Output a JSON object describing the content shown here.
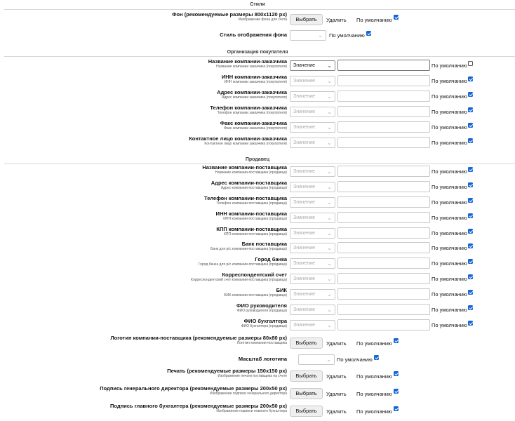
{
  "styles": {
    "title": "Стили",
    "background": {
      "label": "Фон (рекомендуемые размеры 800x1120 px)",
      "sub": "Изображение фона для счета",
      "button": "Выбрать",
      "delete": "Удалить",
      "default_label": "По умолчанию",
      "default_checked": true
    },
    "bg_display": {
      "label": "Стиль отображения фона",
      "default_label": "По умолчанию",
      "default_checked": true
    }
  },
  "buyer": {
    "title": "Организация покупателя",
    "rows": [
      {
        "label": "Название компании-заказчика",
        "sub": "Название компании заказчика (покупателя)",
        "select": "Значение",
        "default_label": "По умолчанию",
        "checked": false,
        "active": true
      },
      {
        "label": "ИНН компании-заказчика",
        "sub": "ИНН компании заказчика (покупателя)",
        "select": "Значение",
        "default_label": "По умолчанию",
        "checked": true
      },
      {
        "label": "Адрес компании-заказчика",
        "sub": "Адрес компании заказчика (покупателя)",
        "select": "Значение",
        "default_label": "По умолчанию",
        "checked": true
      },
      {
        "label": "Телефон компании-заказчика",
        "sub": "Телефон компании заказчика (покупателя)",
        "select": "Значение",
        "default_label": "По умолчанию",
        "checked": true
      },
      {
        "label": "Факс компании-заказчика",
        "sub": "Факс компании заказчика (покупателя)",
        "select": "Значение",
        "default_label": "По умолчанию",
        "checked": true
      },
      {
        "label": "Контактное лицо компании-заказчика",
        "sub": "Контактное лицо компании заказчика (покупателя)",
        "select": "Значение",
        "default_label": "По умолчанию",
        "checked": true
      }
    ]
  },
  "seller": {
    "title": "Продавец",
    "rows": [
      {
        "label": "Название компании-поставщика",
        "sub": "Название компании-поставщика (продавца)",
        "select": "Значение",
        "default_label": "По умолчанию",
        "checked": true
      },
      {
        "label": "Адрес компании-поставщика",
        "sub": "Адрес компании-поставщика (продавца)",
        "select": "Значение",
        "default_label": "По умолчанию",
        "checked": true
      },
      {
        "label": "Телефон компании-поставщика",
        "sub": "Телефон компании-поставщика (продавца)",
        "select": "Значение",
        "default_label": "По умолчанию",
        "checked": true
      },
      {
        "label": "ИНН компании-поставщика",
        "sub": "ИНН компании-поставщика (продавца)",
        "select": "Значение",
        "default_label": "По умолчанию",
        "checked": true
      },
      {
        "label": "КПП компании-поставщика",
        "sub": "КПП компании-поставщика (продавца)",
        "select": "Значение",
        "default_label": "По умолчанию",
        "checked": true
      },
      {
        "label": "Банк поставщика",
        "sub": "Банк для р/с компании-поставщика (продавца)",
        "select": "Значение",
        "default_label": "По умолчанию",
        "checked": true
      },
      {
        "label": "Город банка",
        "sub": "Город банка для р/с компании-поставщика (продавца)",
        "select": "Значение",
        "default_label": "По умолчанию",
        "checked": true
      },
      {
        "label": "Корреспондентский счет",
        "sub": "Корреспондентский счет компании-поставщика (продавца)",
        "select": "Значение",
        "default_label": "По умолчанию",
        "checked": true
      },
      {
        "label": "БИК",
        "sub": "БИК компании-поставщика (продавца)",
        "select": "Значение",
        "default_label": "По умолчанию",
        "checked": true
      },
      {
        "label": "ФИО руководителя",
        "sub": "ФИО руководителя (продавца)",
        "select": "Значение",
        "default_label": "По умолчанию",
        "checked": true
      },
      {
        "label": "ФИО бухгалтера",
        "sub": "ФИО бухгалтера (продавца)",
        "select": "Значение",
        "default_label": "По умолчанию",
        "checked": true
      }
    ],
    "logo": {
      "label": "Логотип компании-поставщика (рекомендуемые размеры 80x80 px)",
      "sub": "Логотип компании-поставщика",
      "button": "Выбрать",
      "delete": "Удалить",
      "default_label": "По умолчанию",
      "checked": true
    },
    "logo_scale": {
      "label": "Масштаб логотипа",
      "default_label": "По умолчанию",
      "checked": true
    },
    "print": {
      "label": "Печать (рекомендуемые размеры 150x150 px)",
      "sub": "Изображение печати поставщика на счете",
      "button": "Выбрать",
      "delete": "Удалить",
      "default_label": "По умолчанию",
      "checked": true
    },
    "director_sign": {
      "label": "Подпись генерального директора (рекомендуемые размеры 200x50 px)",
      "sub": "Изображение подписи генерального директора",
      "button": "Выбрать",
      "delete": "Удалить",
      "default_label": "По умолчанию",
      "checked": true
    },
    "accountant_sign": {
      "label": "Подпись главного бухгалтера (рекомендуемые размеры 200x50 px)",
      "sub": "Изображение подписи главного бухгалтера",
      "button": "Выбрать",
      "delete": "Удалить",
      "default_label": "По умолчанию",
      "checked": true
    }
  }
}
